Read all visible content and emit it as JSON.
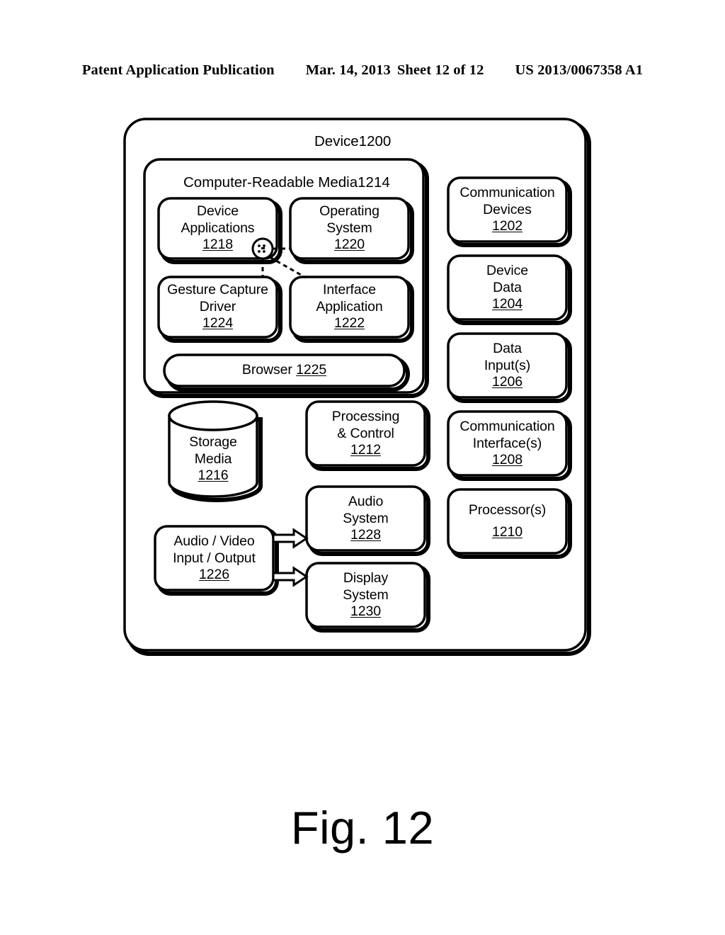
{
  "header": {
    "publication": "Patent Application Publication",
    "date": "Mar. 14, 2013",
    "sheet": "Sheet 12 of 12",
    "patent_number": "US 2013/0067358 A1"
  },
  "figure": {
    "caption": "Fig. 12",
    "device_title": {
      "label": "Device",
      "ref": "1200"
    },
    "crm_title": {
      "label": "Computer-Readable Media",
      "ref": "1214"
    },
    "blocks": {
      "device_applications": {
        "line1": "Device",
        "line2": "Applications",
        "ref": "1218"
      },
      "operating_system": {
        "line1": "Operating",
        "line2": "System",
        "ref": "1220"
      },
      "gesture_capture_driver": {
        "line1": "Gesture Capture",
        "line2": "Driver",
        "ref": "1224"
      },
      "interface_application": {
        "line1": "Interface",
        "line2": "Application",
        "ref": "1222"
      },
      "browser": {
        "line1": "Browser",
        "ref": "1225"
      },
      "storage_media": {
        "line1": "Storage",
        "line2": "Media",
        "ref": "1216"
      },
      "processing_control": {
        "line1": "Processing",
        "line2": "& Control",
        "ref": "1212"
      },
      "audio_video_io": {
        "line1": "Audio / Video",
        "line2": "Input / Output",
        "ref": "1226"
      },
      "audio_system": {
        "line1": "Audio",
        "line2": "System",
        "ref": "1228"
      },
      "display_system": {
        "line1": "Display",
        "line2": "System",
        "ref": "1230"
      },
      "communication_devices": {
        "line1": "Communication",
        "line2": "Devices",
        "ref": "1202"
      },
      "device_data": {
        "line1": "Device",
        "line2": "Data",
        "ref": "1204"
      },
      "data_inputs": {
        "line1": "Data",
        "line2": "Input(s)",
        "ref": "1206"
      },
      "communication_interfaces": {
        "line1": "Communication",
        "line2": "Interface(s)",
        "ref": "1208"
      },
      "processors": {
        "line1": "Processor(s)",
        "line2": "",
        "ref": "1210"
      }
    },
    "colors": {
      "ink": "#000000",
      "paper": "#ffffff"
    }
  }
}
